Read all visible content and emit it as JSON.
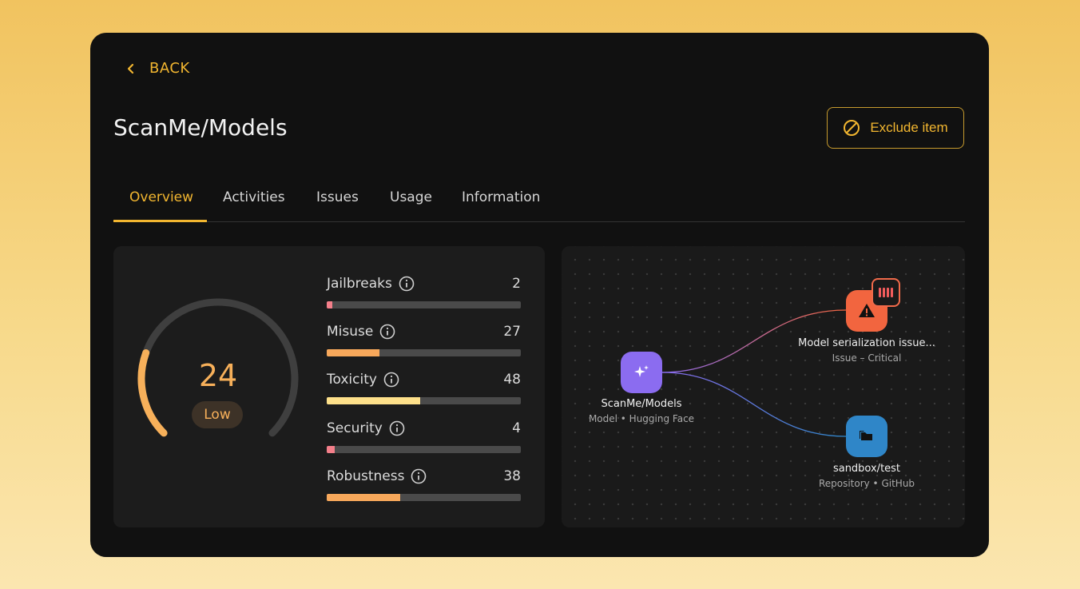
{
  "nav": {
    "back_label": "BACK"
  },
  "page": {
    "title": "ScanMe/Models",
    "exclude_label": "Exclude item"
  },
  "tabs": [
    {
      "label": "Overview",
      "active": true
    },
    {
      "label": "Activities",
      "active": false
    },
    {
      "label": "Issues",
      "active": false
    },
    {
      "label": "Usage",
      "active": false
    },
    {
      "label": "Information",
      "active": false
    }
  ],
  "risk": {
    "score": "24",
    "level": "Low",
    "score_value": 24,
    "score_max": 100,
    "color": "#f7b05a"
  },
  "metrics": [
    {
      "name": "Jailbreaks",
      "value": "2",
      "value_num": 2,
      "color": "#f47f8a"
    },
    {
      "name": "Misuse",
      "value": "27",
      "value_num": 27,
      "color": "#f7a85b"
    },
    {
      "name": "Toxicity",
      "value": "48",
      "value_num": 48,
      "color": "#fde08a"
    },
    {
      "name": "Security",
      "value": "4",
      "value_num": 4,
      "color": "#f47f8a"
    },
    {
      "name": "Robustness",
      "value": "38",
      "value_num": 38,
      "color": "#f7a85b"
    }
  ],
  "graph": {
    "source": {
      "title": "ScanMe/Models",
      "subtitle": "Model • Hugging Face",
      "icon": "sparkle-icon",
      "color": "#8b6cf0"
    },
    "issue": {
      "title": "Model serialization issue...",
      "subtitle": "Issue – Critical",
      "icon": "warning-icon",
      "color": "#f2653f"
    },
    "repo": {
      "title": "sandbox/test",
      "subtitle": "Repository • GitHub",
      "icon": "folder-icon",
      "color": "#2f86c8"
    }
  },
  "colors": {
    "accent": "#f2b630",
    "background": "#111111",
    "panel": "#1c1c1c"
  }
}
